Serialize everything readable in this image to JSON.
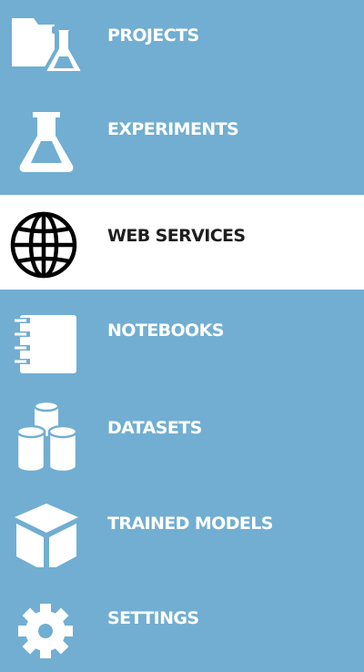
{
  "sidebar": {
    "items": [
      {
        "label": "PROJECTS",
        "icon": "folder-flask-icon",
        "active": false
      },
      {
        "label": "EXPERIMENTS",
        "icon": "flask-icon",
        "active": false
      },
      {
        "label": "WEB SERVICES",
        "icon": "globe-icon",
        "active": true
      },
      {
        "label": "NOTEBOOKS",
        "icon": "notebook-icon",
        "active": false
      },
      {
        "label": "DATASETS",
        "icon": "database-cylinders-icon",
        "active": false
      },
      {
        "label": "TRAINED MODELS",
        "icon": "cube-icon",
        "active": false
      },
      {
        "label": "SETTINGS",
        "icon": "gear-icon",
        "active": false
      }
    ]
  },
  "colors": {
    "background": "#71aed2",
    "active_background": "#ffffff",
    "label": "#ffffff",
    "active_label": "#1e1e1e",
    "active_icon": "#000000"
  }
}
